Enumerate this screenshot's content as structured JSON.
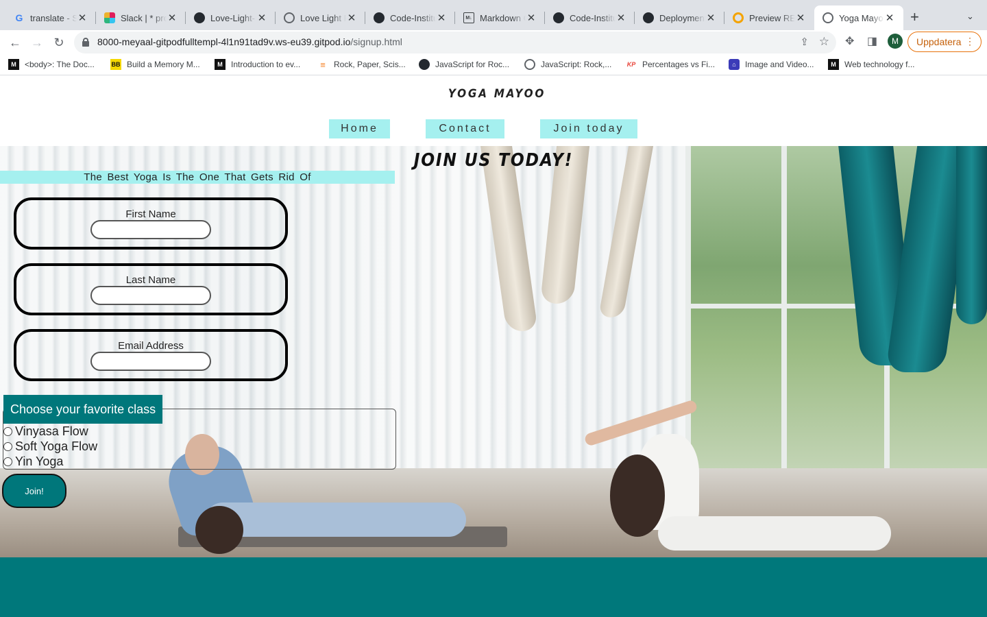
{
  "browser": {
    "tabs": [
      {
        "title": "translate - Sök",
        "icon": "google-icon",
        "active": false
      },
      {
        "title": "Slack | * project",
        "icon": "slack-icon",
        "active": false
      },
      {
        "title": "Love-Light-",
        "icon": "github-icon",
        "active": false
      },
      {
        "title": "Love Light Pilates",
        "icon": "globe-icon",
        "active": false
      },
      {
        "title": "Code-Institute",
        "icon": "github-icon",
        "active": false
      },
      {
        "title": "Markdown Cheatsheet",
        "icon": "markdown-icon",
        "active": false
      },
      {
        "title": "Code-Institute",
        "icon": "github-icon",
        "active": false
      },
      {
        "title": "Deployment",
        "icon": "github-icon",
        "active": false
      },
      {
        "title": "Preview README",
        "icon": "preview-icon",
        "active": false
      },
      {
        "title": "Yoga Mayoo",
        "icon": "globe-icon",
        "active": true
      }
    ],
    "url_host": "8000-meyaal-gitpodfulltempl-4l1n91tad9v.ws-eu39.gitpod.io",
    "url_path": "/signup.html",
    "profile_initial": "M",
    "update_label": "Uppdatera",
    "bookmarks": [
      {
        "label": "<body>: The Doc...",
        "icon": "mdn-icon"
      },
      {
        "label": "Build a Memory M...",
        "icon": "bb-icon"
      },
      {
        "label": "Introduction to ev...",
        "icon": "mdn-icon"
      },
      {
        "label": "Rock, Paper, Scis...",
        "icon": "stackoverflow-icon"
      },
      {
        "label": "JavaScript for Roc...",
        "icon": "github-icon"
      },
      {
        "label": "JavaScript: Rock,...",
        "icon": "globe-icon"
      },
      {
        "label": "Percentages vs Fi...",
        "icon": "kp-icon"
      },
      {
        "label": "Image and Video...",
        "icon": "image-host-icon"
      },
      {
        "label": "Web technology f...",
        "icon": "mdn-icon"
      }
    ]
  },
  "site": {
    "brand": "YOGA MAYOO",
    "nav": [
      "Home",
      "Contact",
      "Join today"
    ],
    "hero_title": "JOIN US TODAY!",
    "tagline": "The Best Yoga Is The One That Gets Rid Of",
    "fields": [
      {
        "label": "First Name",
        "value": ""
      },
      {
        "label": "Last Name",
        "value": ""
      },
      {
        "label": "Email Address",
        "value": ""
      }
    ],
    "class_legend": "Choose your favorite class",
    "classes": [
      "Vinyasa Flow",
      "Soft Yoga Flow",
      "Yin Yoga"
    ],
    "submit_label": "Join!"
  },
  "colors": {
    "accent_light": "#a5f0ef",
    "accent_dark": "#00777b",
    "footer": "#00787b",
    "update_orange": "#e8710a"
  }
}
